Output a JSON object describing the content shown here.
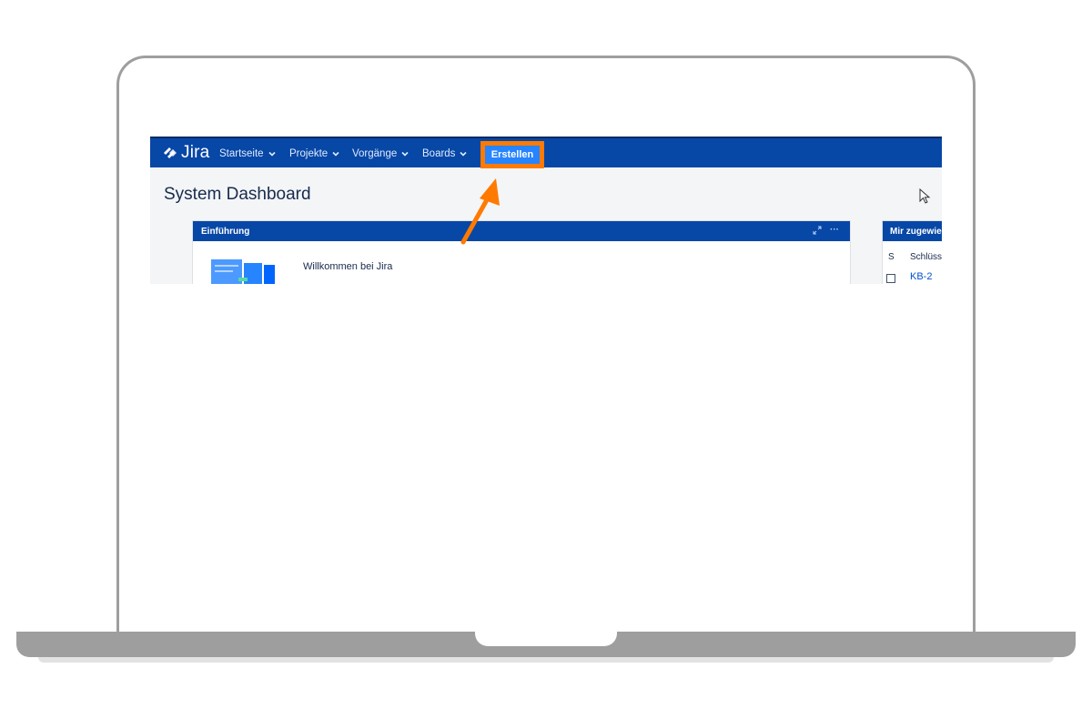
{
  "header": {
    "logo_text": "Jira",
    "nav": [
      {
        "label": "Startseite"
      },
      {
        "label": "Projekte"
      },
      {
        "label": "Vorgänge"
      },
      {
        "label": "Boards"
      }
    ],
    "create_button": "Erstellen"
  },
  "page": {
    "title": "System Dashboard"
  },
  "gadget_intro": {
    "title": "Einführung",
    "welcome": "Willkommen bei Jira",
    "tools_dots": "···"
  },
  "gadget_assigned": {
    "title": "Mir zugewie",
    "col_status": "S",
    "col_key": "Schlüss",
    "row_key": "KB-2"
  },
  "colors": {
    "topbar": "#0747a6",
    "create": "#2684ff",
    "highlight": "#ff7a00"
  },
  "icons": [
    "jira-logo-icon",
    "chevron-down-icon",
    "expand-icon",
    "more-icon",
    "cursor-icon",
    "arrow-annotation-icon"
  ]
}
